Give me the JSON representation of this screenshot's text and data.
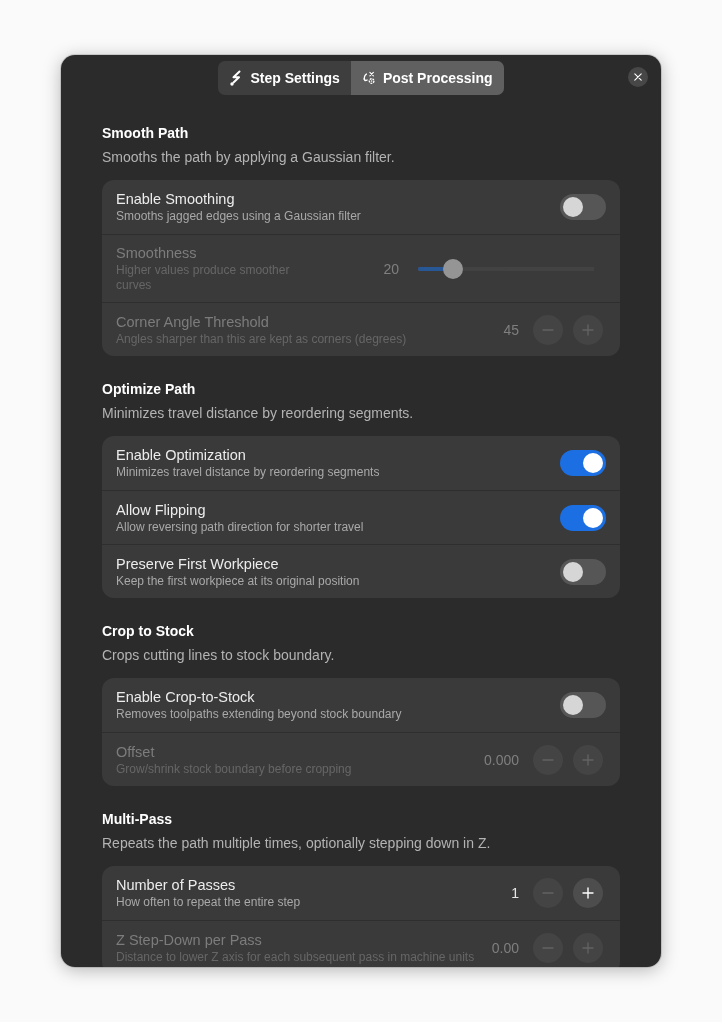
{
  "dialog": {
    "tabs": [
      {
        "label": "Step Settings",
        "selected": false
      },
      {
        "label": "Post Processing",
        "selected": true
      }
    ]
  },
  "sections": [
    {
      "title": "Smooth Path",
      "description": "Smooths the path by applying a Gaussian filter.",
      "rows": [
        {
          "kind": "switch",
          "title": "Enable Smoothing",
          "subtitle": "Smooths jagged edges using a Gaussian filter",
          "disabled": false,
          "on": false
        },
        {
          "kind": "slider",
          "title": "Smoothness",
          "subtitle": "Higher values produce smoother curves",
          "disabled": true,
          "value": "20",
          "level": 0.2
        },
        {
          "kind": "stepper",
          "title": "Corner Angle Threshold",
          "subtitle": "Angles sharper than this are kept as corners (degrees)",
          "disabled": true,
          "value": "45",
          "buttons": [
            {
              "kind": "decrement",
              "disabled": true
            },
            {
              "kind": "increment",
              "disabled": true
            }
          ]
        }
      ]
    },
    {
      "title": "Optimize Path",
      "description": "Minimizes travel distance by reordering segments.",
      "rows": [
        {
          "kind": "switch",
          "title": "Enable Optimization",
          "subtitle": "Minimizes travel distance by reordering segments",
          "disabled": false,
          "on": true
        },
        {
          "kind": "switch",
          "title": "Allow Flipping",
          "subtitle": "Allow reversing path direction for shorter travel",
          "disabled": false,
          "on": true
        },
        {
          "kind": "switch",
          "title": "Preserve First Workpiece",
          "subtitle": "Keep the first workpiece at its original position",
          "disabled": false,
          "on": false
        }
      ]
    },
    {
      "title": "Crop to Stock",
      "description": "Crops cutting lines to stock boundary.",
      "rows": [
        {
          "kind": "switch",
          "title": "Enable Crop-to-Stock",
          "subtitle": "Removes toolpaths extending beyond stock boundary",
          "disabled": false,
          "on": false
        },
        {
          "kind": "stepper",
          "title": "Offset",
          "subtitle": "Grow/shrink stock boundary before cropping",
          "disabled": true,
          "value": "0.000",
          "buttons": [
            {
              "kind": "decrement",
              "disabled": true
            },
            {
              "kind": "increment",
              "disabled": true
            }
          ]
        }
      ]
    },
    {
      "title": "Multi-Pass",
      "description": "Repeats the path multiple times, optionally stepping down in Z.",
      "rows": [
        {
          "kind": "stepper",
          "title": "Number of Passes",
          "subtitle": "How often to repeat the entire step",
          "disabled": false,
          "value": "1",
          "buttons": [
            {
              "kind": "decrement",
              "disabled": true
            },
            {
              "kind": "increment",
              "disabled": false
            }
          ]
        },
        {
          "kind": "stepper",
          "title": "Z Step-Down per Pass",
          "subtitle": "Distance to lower Z axis for each subsequent pass in machine units",
          "disabled": true,
          "value": "0.00",
          "buttons": [
            {
              "kind": "decrement",
              "disabled": true
            },
            {
              "kind": "increment",
              "disabled": true
            }
          ]
        }
      ]
    }
  ]
}
